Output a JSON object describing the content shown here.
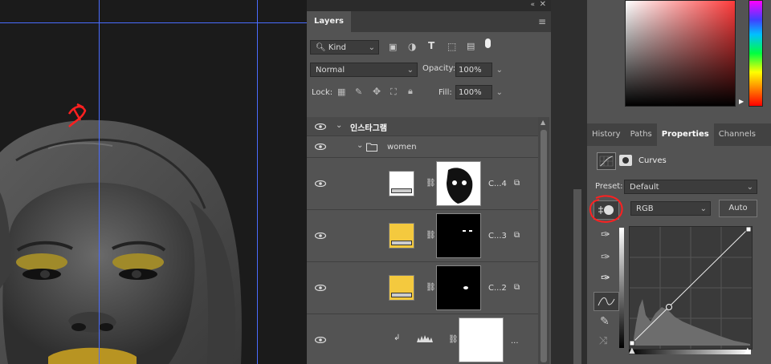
{
  "layers_panel": {
    "tab": "Layers",
    "filter_kind": "Kind",
    "blend_mode": "Normal",
    "opacity_label": "Opacity:",
    "opacity_value": "100%",
    "lock_label": "Lock:",
    "fill_label": "Fill:",
    "fill_value": "100%",
    "group_name": "인스타그램",
    "subgroup_name": "women",
    "layers": [
      {
        "name": "C...4",
        "thumb": "white",
        "mask": "face"
      },
      {
        "name": "C...3",
        "thumb": "yellow",
        "mask": "eyes"
      },
      {
        "name": "C...2",
        "thumb": "yellow",
        "mask": "lips"
      },
      {
        "name": "...",
        "thumb": "levels",
        "mask": "white"
      }
    ]
  },
  "right_panel": {
    "tabs": [
      "History",
      "Paths",
      "Properties",
      "Channels"
    ],
    "active_tab": "Properties",
    "adjustment_title": "Curves",
    "preset_label": "Preset:",
    "preset_value": "Default",
    "channel_value": "RGB",
    "auto_label": "Auto"
  }
}
